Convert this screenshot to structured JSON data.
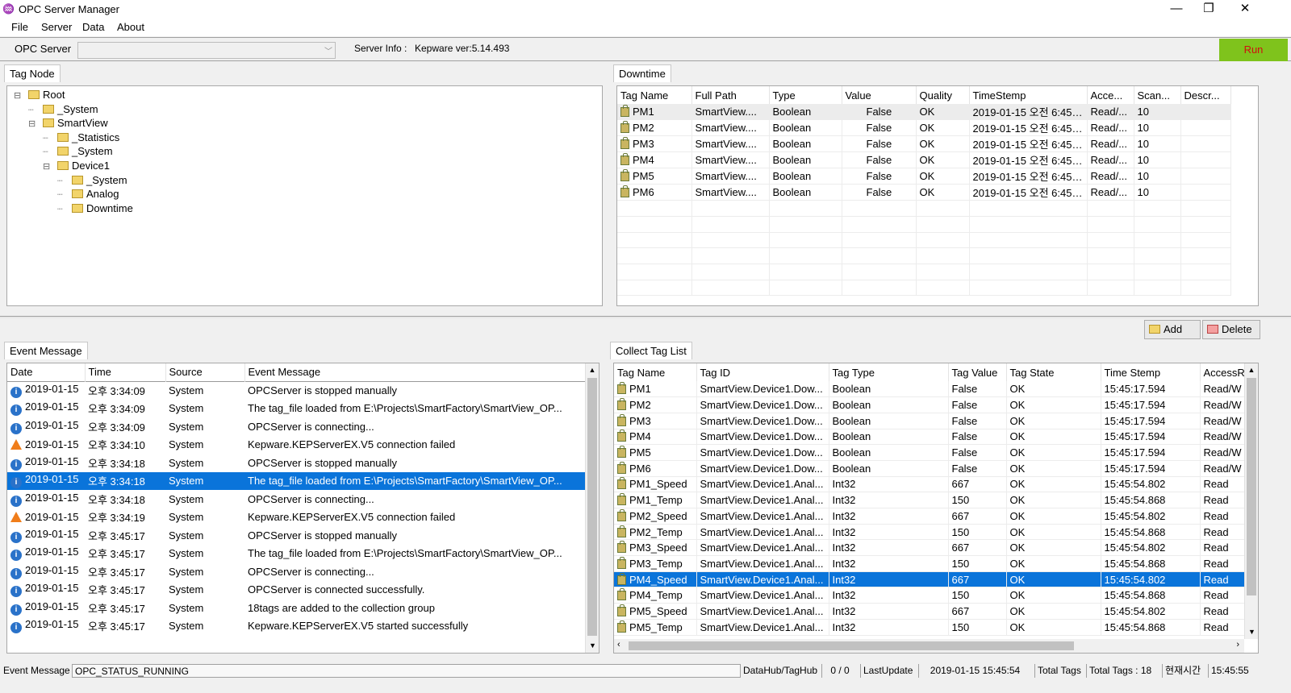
{
  "window": {
    "title": "OPC Server Manager",
    "minimize": "—",
    "maximize": "❐",
    "close": "✕"
  },
  "menu": [
    "File",
    "Server",
    "Data",
    "About"
  ],
  "toolbar": {
    "opc_server_label": "OPC Server",
    "server_info_label": "Server Info :",
    "server_info_value": "Kepware ver:5.14.493",
    "run_label": "Run",
    "combo_value": ""
  },
  "tag_node": {
    "tab": "Tag Node",
    "tree": [
      {
        "label": "Root",
        "depth": 0,
        "exp": "⊟"
      },
      {
        "label": "_System",
        "depth": 1,
        "exp": ""
      },
      {
        "label": "SmartView",
        "depth": 1,
        "exp": "⊟"
      },
      {
        "label": "_Statistics",
        "depth": 2,
        "exp": ""
      },
      {
        "label": "_System",
        "depth": 2,
        "exp": ""
      },
      {
        "label": "Device1",
        "depth": 2,
        "exp": "⊟"
      },
      {
        "label": "_System",
        "depth": 3,
        "exp": ""
      },
      {
        "label": "Analog",
        "depth": 3,
        "exp": ""
      },
      {
        "label": "Downtime",
        "depth": 3,
        "exp": ""
      }
    ]
  },
  "downtime": {
    "tab": "Downtime",
    "columns": [
      "Tag Name",
      "Full Path",
      "Type",
      "Value",
      "Quality",
      "TimeStemp",
      "Acce...",
      "Scan...",
      "Descr..."
    ],
    "rows": [
      [
        "PM1",
        "SmartView....",
        "Boolean",
        "False",
        "OK",
        "2019-01-15 오전 6:45:...",
        "Read/...",
        "10",
        ""
      ],
      [
        "PM2",
        "SmartView....",
        "Boolean",
        "False",
        "OK",
        "2019-01-15 오전 6:45:...",
        "Read/...",
        "10",
        ""
      ],
      [
        "PM3",
        "SmartView....",
        "Boolean",
        "False",
        "OK",
        "2019-01-15 오전 6:45:...",
        "Read/...",
        "10",
        ""
      ],
      [
        "PM4",
        "SmartView....",
        "Boolean",
        "False",
        "OK",
        "2019-01-15 오전 6:45:...",
        "Read/...",
        "10",
        ""
      ],
      [
        "PM5",
        "SmartView....",
        "Boolean",
        "False",
        "OK",
        "2019-01-15 오전 6:45:...",
        "Read/...",
        "10",
        ""
      ],
      [
        "PM6",
        "SmartView....",
        "Boolean",
        "False",
        "OK",
        "2019-01-15 오전 6:45:...",
        "Read/...",
        "10",
        ""
      ]
    ]
  },
  "buttons": {
    "add": "Add",
    "delete": "Delete"
  },
  "events": {
    "tab": "Event Message",
    "columns": [
      "Date",
      "Time",
      "Source",
      "Event Message"
    ],
    "rows": [
      {
        "icon": "info",
        "date": "2019-01-15",
        "time": "오후 3:34:09",
        "source": "System",
        "msg": "OPCServer is stopped manually"
      },
      {
        "icon": "info",
        "date": "2019-01-15",
        "time": "오후 3:34:09",
        "source": "System",
        "msg": "The tag_file loaded from E:\\Projects\\SmartFactory\\SmartView_OP..."
      },
      {
        "icon": "info",
        "date": "2019-01-15",
        "time": "오후 3:34:09",
        "source": "System",
        "msg": "OPCServer is connecting..."
      },
      {
        "icon": "warn",
        "date": "2019-01-15",
        "time": "오후 3:34:10",
        "source": "System",
        "msg": "Kepware.KEPServerEX.V5 connection failed"
      },
      {
        "icon": "info",
        "date": "2019-01-15",
        "time": "오후 3:34:18",
        "source": "System",
        "msg": "OPCServer is stopped manually"
      },
      {
        "icon": "info",
        "date": "2019-01-15",
        "time": "오후 3:34:18",
        "source": "System",
        "msg": "The tag_file loaded from E:\\Projects\\SmartFactory\\SmartView_OP...",
        "selected": true
      },
      {
        "icon": "info",
        "date": "2019-01-15",
        "time": "오후 3:34:18",
        "source": "System",
        "msg": "OPCServer is connecting..."
      },
      {
        "icon": "warn",
        "date": "2019-01-15",
        "time": "오후 3:34:19",
        "source": "System",
        "msg": "Kepware.KEPServerEX.V5 connection failed"
      },
      {
        "icon": "info",
        "date": "2019-01-15",
        "time": "오후 3:45:17",
        "source": "System",
        "msg": "OPCServer is stopped manually"
      },
      {
        "icon": "info",
        "date": "2019-01-15",
        "time": "오후 3:45:17",
        "source": "System",
        "msg": "The tag_file loaded from E:\\Projects\\SmartFactory\\SmartView_OP..."
      },
      {
        "icon": "info",
        "date": "2019-01-15",
        "time": "오후 3:45:17",
        "source": "System",
        "msg": "OPCServer is connecting..."
      },
      {
        "icon": "info",
        "date": "2019-01-15",
        "time": "오후 3:45:17",
        "source": "System",
        "msg": "OPCServer is connected successfully."
      },
      {
        "icon": "info",
        "date": "2019-01-15",
        "time": "오후 3:45:17",
        "source": "System",
        "msg": "18tags are added to the collection group"
      },
      {
        "icon": "info",
        "date": "2019-01-15",
        "time": "오후 3:45:17",
        "source": "System",
        "msg": "Kepware.KEPServerEX.V5 started successfully"
      }
    ]
  },
  "collect": {
    "tab": "Collect Tag List",
    "columns": [
      "Tag Name",
      "Tag ID",
      "Tag Type",
      "Tag Value",
      "Tag State",
      "Time Stemp",
      "AccessR"
    ],
    "rows": [
      [
        "PM1",
        "SmartView.Device1.Dow...",
        "Boolean",
        "False",
        "OK",
        "15:45:17.594",
        "Read/W"
      ],
      [
        "PM2",
        "SmartView.Device1.Dow...",
        "Boolean",
        "False",
        "OK",
        "15:45:17.594",
        "Read/W"
      ],
      [
        "PM3",
        "SmartView.Device1.Dow...",
        "Boolean",
        "False",
        "OK",
        "15:45:17.594",
        "Read/W"
      ],
      [
        "PM4",
        "SmartView.Device1.Dow...",
        "Boolean",
        "False",
        "OK",
        "15:45:17.594",
        "Read/W"
      ],
      [
        "PM5",
        "SmartView.Device1.Dow...",
        "Boolean",
        "False",
        "OK",
        "15:45:17.594",
        "Read/W"
      ],
      [
        "PM6",
        "SmartView.Device1.Dow...",
        "Boolean",
        "False",
        "OK",
        "15:45:17.594",
        "Read/W"
      ],
      [
        "PM1_Speed",
        "SmartView.Device1.Anal...",
        "Int32",
        "667",
        "OK",
        "15:45:54.802",
        "Read"
      ],
      [
        "PM1_Temp",
        "SmartView.Device1.Anal...",
        "Int32",
        "150",
        "OK",
        "15:45:54.868",
        "Read"
      ],
      [
        "PM2_Speed",
        "SmartView.Device1.Anal...",
        "Int32",
        "667",
        "OK",
        "15:45:54.802",
        "Read"
      ],
      [
        "PM2_Temp",
        "SmartView.Device1.Anal...",
        "Int32",
        "150",
        "OK",
        "15:45:54.868",
        "Read"
      ],
      [
        "PM3_Speed",
        "SmartView.Device1.Anal...",
        "Int32",
        "667",
        "OK",
        "15:45:54.802",
        "Read"
      ],
      [
        "PM3_Temp",
        "SmartView.Device1.Anal...",
        "Int32",
        "150",
        "OK",
        "15:45:54.868",
        "Read"
      ],
      [
        "PM4_Speed",
        "SmartView.Device1.Anal...",
        "Int32",
        "667",
        "OK",
        "15:45:54.802",
        "Read"
      ],
      [
        "PM4_Temp",
        "SmartView.Device1.Anal...",
        "Int32",
        "150",
        "OK",
        "15:45:54.868",
        "Read"
      ],
      [
        "PM5_Speed",
        "SmartView.Device1.Anal...",
        "Int32",
        "667",
        "OK",
        "15:45:54.802",
        "Read"
      ],
      [
        "PM5_Temp",
        "SmartView.Device1.Anal...",
        "Int32",
        "150",
        "OK",
        "15:45:54.868",
        "Read"
      ]
    ],
    "selected_index": 12
  },
  "status": {
    "event_label": "Event Message",
    "event_value": "OPC_STATUS_RUNNING",
    "datahub": "DataHub/TagHub",
    "datahub_value": "0 / 0",
    "lastupdate": "LastUpdate",
    "lastupdate_value": "2019-01-15 15:45:54",
    "total_tags": "Total Tags",
    "total_tags_value": "Total Tags : 18",
    "current_time_label": "현재시간",
    "current_time": "15:45:55"
  }
}
